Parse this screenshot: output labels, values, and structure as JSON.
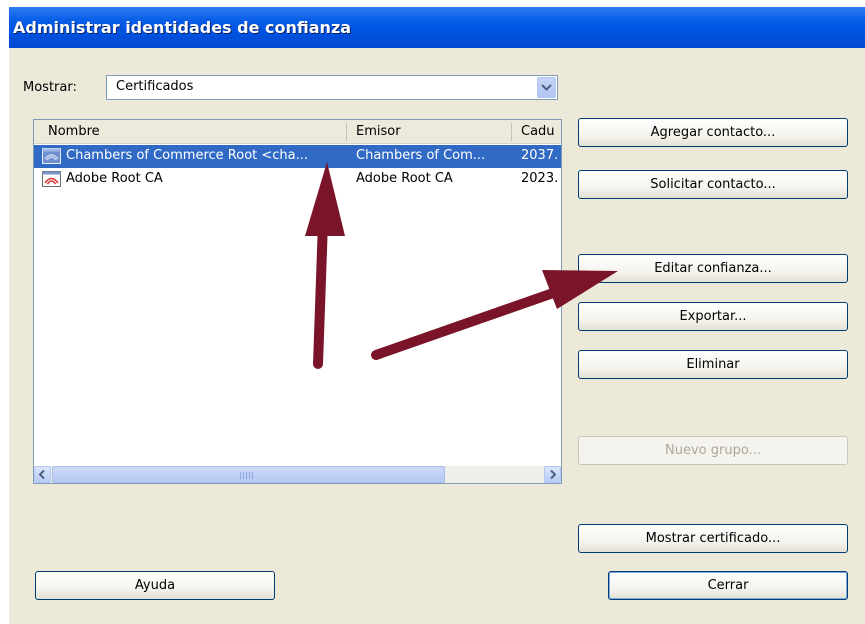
{
  "window": {
    "title": "Administrar identidades de confianza"
  },
  "filter": {
    "label": "Mostrar:",
    "value": "Certificados"
  },
  "list": {
    "columns": [
      "Nombre",
      "Emisor",
      "Cadu"
    ],
    "rows": [
      {
        "name": "Chambers of Commerce Root <cha...",
        "issuer": "Chambers of Com...",
        "expiry": "2037.",
        "selected": true
      },
      {
        "name": "Adobe Root CA",
        "issuer": "Adobe Root CA",
        "expiry": "2023.",
        "selected": false
      }
    ]
  },
  "buttons": {
    "add_contact": "Agregar contacto...",
    "request_contact": "Solicitar contacto...",
    "edit_trust": "Editar confianza...",
    "export": "Exportar...",
    "delete": "Eliminar",
    "new_group": "Nuevo grupo...",
    "show_certificate": "Mostrar certificado...",
    "help": "Ayuda",
    "close": "Cerrar"
  },
  "annotations": {
    "arrow_color": "#7a1428"
  },
  "colors": {
    "selection": "#316ac5",
    "titlebar": "#0054e3",
    "dialog_bg": "#ece9d8"
  },
  "icons": {
    "certificate": "certificate-icon",
    "dropdown": "chevron-down-icon",
    "scroll_left": "arrow-left-icon",
    "scroll_right": "arrow-right-icon"
  }
}
